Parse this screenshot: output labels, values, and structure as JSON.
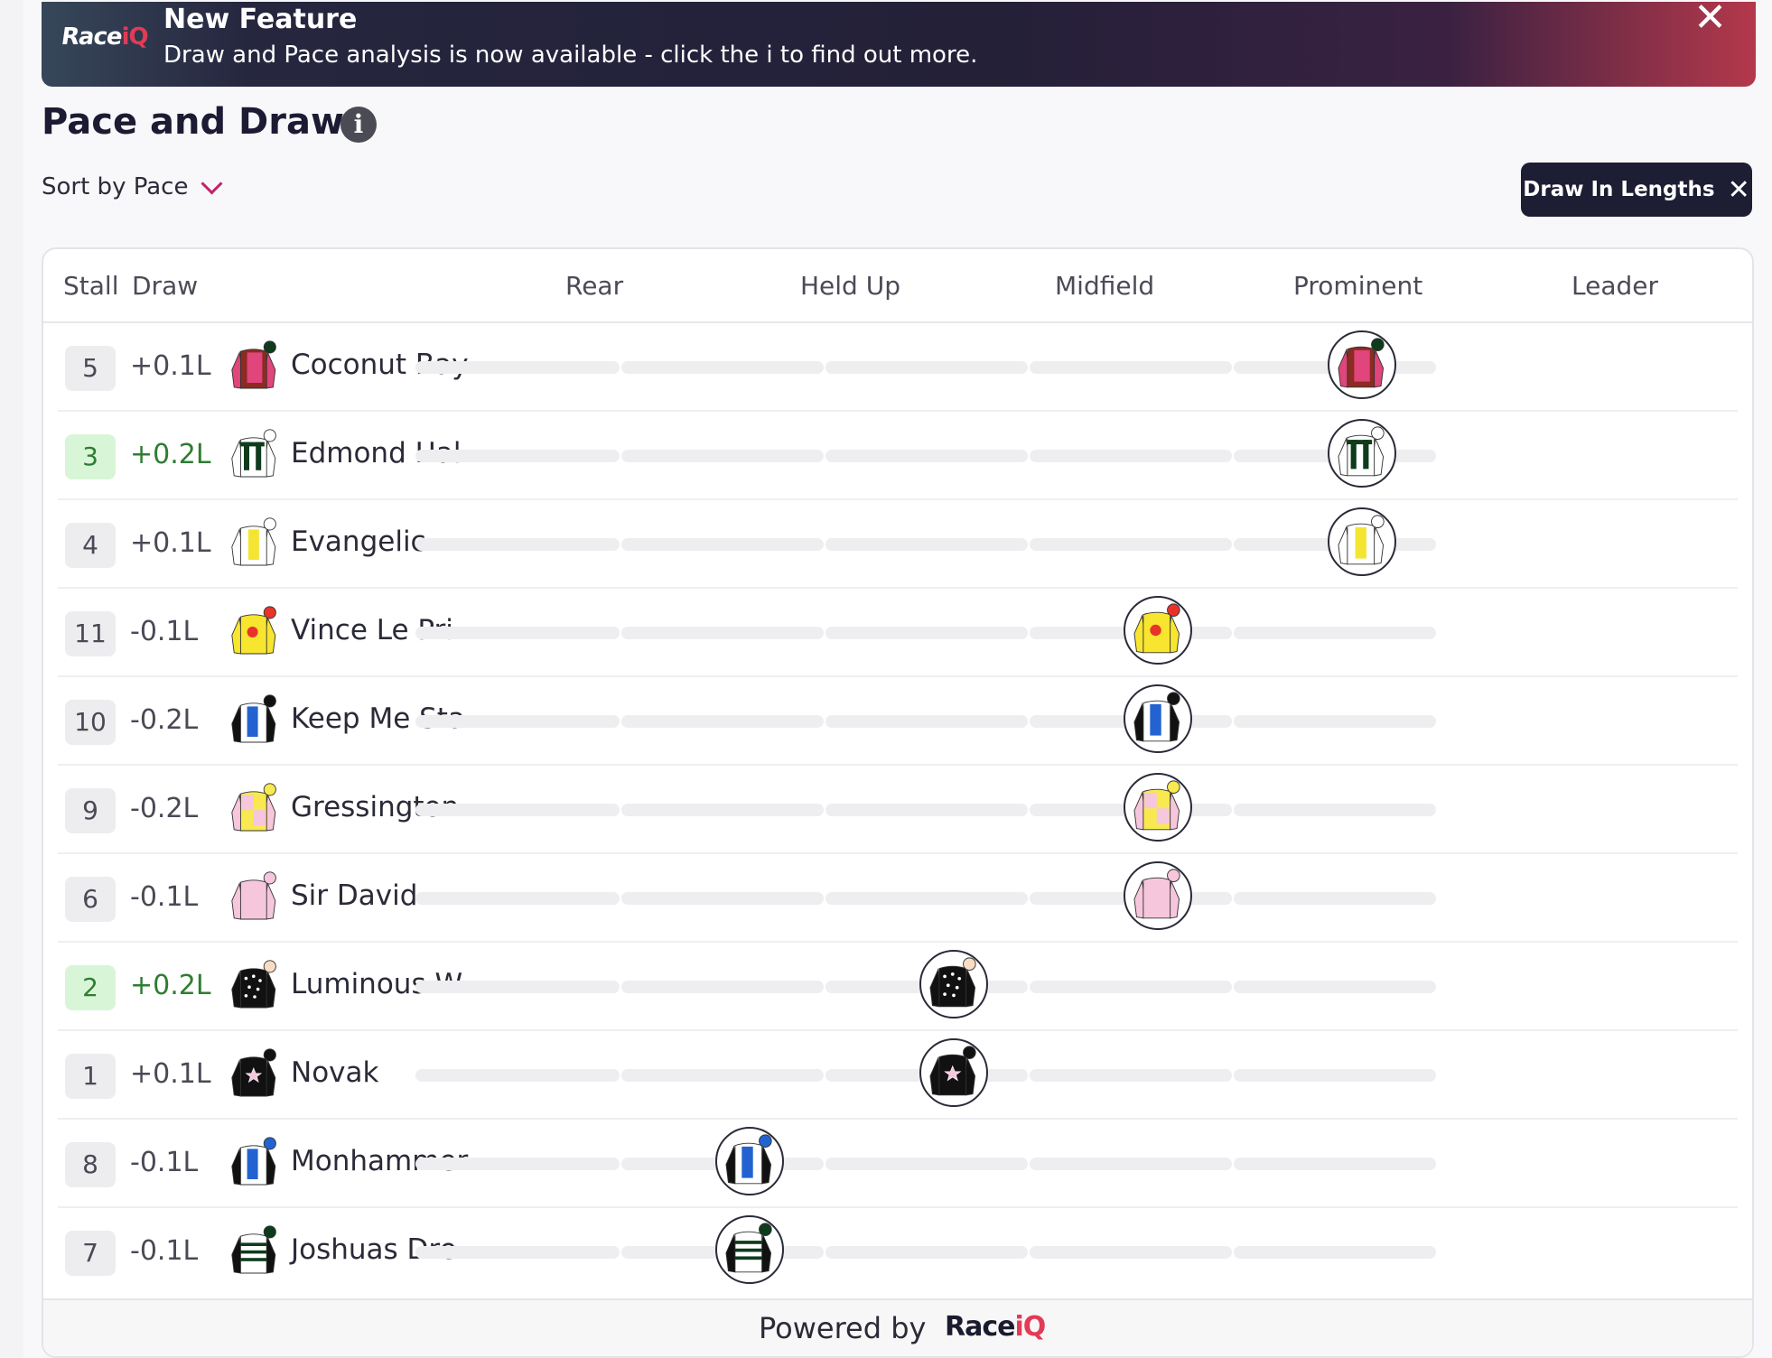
{
  "banner": {
    "logo_text": "Race",
    "logo_accent": "iQ",
    "title": "New Feature",
    "message": "Draw and Pace analysis is now available - click the i to find out more.",
    "close_icon": "close-icon"
  },
  "header": {
    "title": "Pace and Draw",
    "info_icon": "i",
    "sort_label": "Sort by Pace",
    "draw_button_label": "Draw In Lengths"
  },
  "table": {
    "columns": {
      "stall": "Stall",
      "draw": "Draw",
      "rear": "Rear",
      "held_up": "Held Up",
      "midfield": "Midfield",
      "prominent": "Prominent",
      "leader": "Leader"
    },
    "runners": [
      {
        "stall": "5",
        "draw": "+0.1L",
        "name": "Coconut Bay",
        "highlight": false,
        "position": "Leader",
        "silk": {
          "body": "#8b2b22",
          "sleeve": "#e0457b",
          "cap": "#0f3b1d",
          "pattern": "halves"
        }
      },
      {
        "stall": "3",
        "draw": "+0.2L",
        "name": "Edmond Hal...",
        "highlight": true,
        "position": "Leader",
        "silk": {
          "body": "#ffffff",
          "sleeve": "#ffffff",
          "cap": "#ffffff",
          "pattern": "braces-green"
        }
      },
      {
        "stall": "4",
        "draw": "+0.1L",
        "name": "Evangelic",
        "highlight": false,
        "position": "Leader",
        "silk": {
          "body": "#ffffff",
          "sleeve": "#ffffff",
          "cap": "#ffffff",
          "pattern": "stripe-yellow"
        }
      },
      {
        "stall": "11",
        "draw": "-0.1L",
        "name": "Vince Le Pri...",
        "highlight": false,
        "position": "Prominent",
        "silk": {
          "body": "#f7e530",
          "sleeve": "#f7e530",
          "cap": "#e8332a",
          "pattern": "disc-red"
        }
      },
      {
        "stall": "10",
        "draw": "-0.2L",
        "name": "Keep Me Sta...",
        "highlight": false,
        "position": "Prominent",
        "silk": {
          "body": "#ffffff",
          "sleeve": "#111111",
          "cap": "#111111",
          "pattern": "stripe-blue"
        }
      },
      {
        "stall": "9",
        "draw": "-0.2L",
        "name": "Gressington",
        "highlight": false,
        "position": "Prominent",
        "silk": {
          "body": "#f7e94f",
          "sleeve": "#f6c6dd",
          "cap": "#f7e94f",
          "pattern": "quartered"
        }
      },
      {
        "stall": "6",
        "draw": "-0.1L",
        "name": "Sir David",
        "highlight": false,
        "position": "Prominent",
        "silk": {
          "body": "#f6c6dd",
          "sleeve": "#f6c6dd",
          "cap": "#f6c6dd",
          "pattern": "plain"
        }
      },
      {
        "stall": "2",
        "draw": "+0.2L",
        "name": "Luminous W...",
        "highlight": true,
        "position": "Midfield",
        "silk": {
          "body": "#111111",
          "sleeve": "#111111",
          "cap": "#f9dcc4",
          "pattern": "stars"
        }
      },
      {
        "stall": "1",
        "draw": "+0.1L",
        "name": "Novak",
        "highlight": false,
        "position": "Midfield",
        "silk": {
          "body": "#111111",
          "sleeve": "#111111",
          "cap": "#111111",
          "pattern": "star-pink"
        }
      },
      {
        "stall": "8",
        "draw": "-0.1L",
        "name": "Monhammer",
        "highlight": false,
        "position": "Held Up",
        "silk": {
          "body": "#ffffff",
          "sleeve": "#111111",
          "cap": "#2363d1",
          "pattern": "stripe-blue"
        }
      },
      {
        "stall": "7",
        "draw": "-0.1L",
        "name": "Joshuas Dre...",
        "highlight": false,
        "position": "Held Up",
        "silk": {
          "body": "#ffffff",
          "sleeve": "#111111",
          "cap": "#0f3b1d",
          "pattern": "hoops"
        }
      }
    ]
  },
  "footer": {
    "text": "Powered by",
    "logo_text": "Race",
    "logo_accent": "iQ"
  },
  "colors": {
    "accent": "#c2246b",
    "dark": "#1d1d33",
    "highlight_bg": "#d9f5d7",
    "highlight_text": "#2e7d32"
  }
}
